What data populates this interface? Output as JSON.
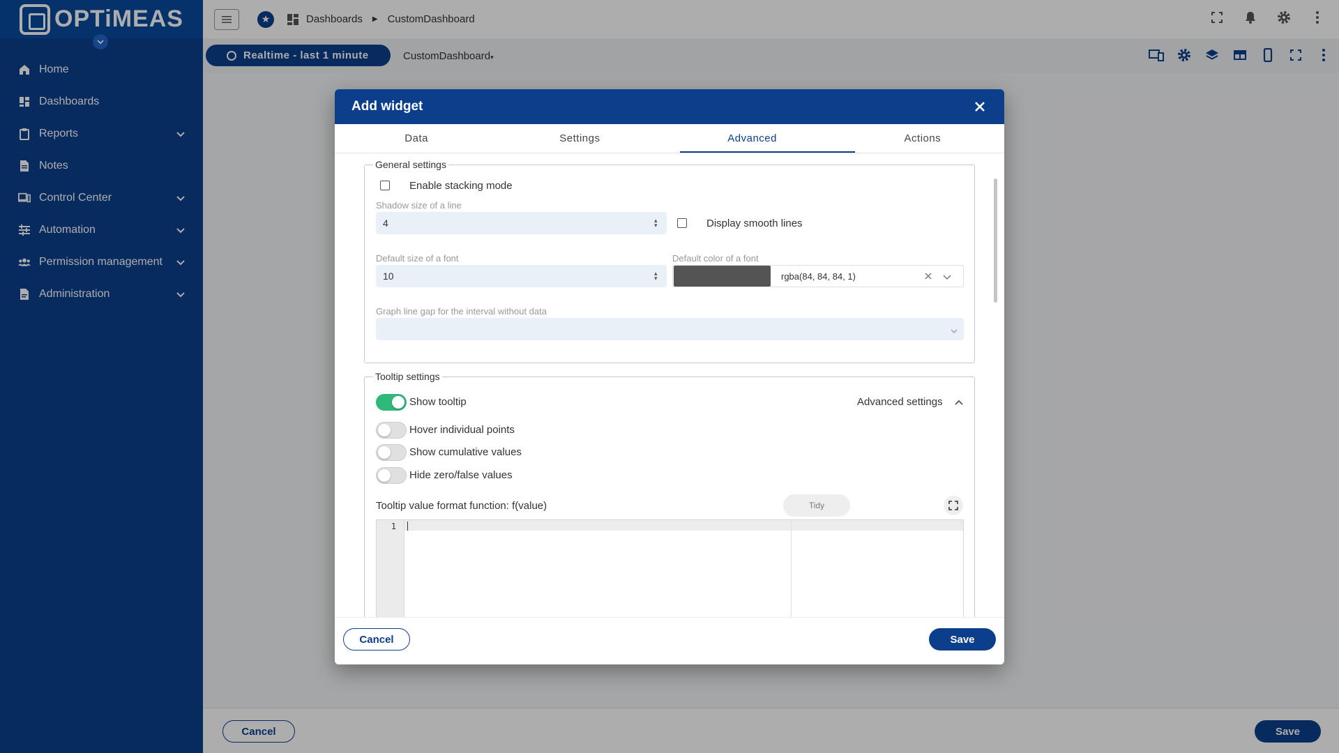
{
  "logo": {
    "text": "OPTiMEAS"
  },
  "sidebar": {
    "items": [
      {
        "label": "Home",
        "icon": "home-icon",
        "expandable": false
      },
      {
        "label": "Dashboards",
        "icon": "dashboard-icon",
        "expandable": false
      },
      {
        "label": "Reports",
        "icon": "clipboard-icon",
        "expandable": true
      },
      {
        "label": "Notes",
        "icon": "note-icon",
        "expandable": false
      },
      {
        "label": "Control Center",
        "icon": "monitor-icon",
        "expandable": true
      },
      {
        "label": "Automation",
        "icon": "sliders-icon",
        "expandable": true
      },
      {
        "label": "Permission management",
        "icon": "users-icon",
        "expandable": true
      },
      {
        "label": "Administration",
        "icon": "document-icon",
        "expandable": true
      }
    ]
  },
  "topbar": {
    "breadcrumb": [
      "Dashboards",
      "CustomDashboard"
    ]
  },
  "dashboard": {
    "realtime_label": "Realtime - last 1 minute",
    "selected_dashboard": "CustomDashboard",
    "cancel_label": "Cancel",
    "save_label": "Save"
  },
  "modal": {
    "title": "Add widget",
    "tabs": [
      "Data",
      "Settings",
      "Advanced",
      "Actions"
    ],
    "active_tab": "Advanced",
    "general": {
      "legend": "General settings",
      "stacking_label": "Enable stacking mode",
      "stacking_checked": false,
      "shadow_label": "Shadow size of a line",
      "shadow_value": "4",
      "smooth_label": "Display smooth lines",
      "smooth_checked": false,
      "font_size_label": "Default size of a font",
      "font_size_value": "10",
      "font_color_label": "Default color of a font",
      "font_color_value": "rgba(84, 84, 84, 1)",
      "font_color_swatch": "#545454",
      "gap_label": "Graph line gap for the interval without data",
      "gap_value": ""
    },
    "tooltip": {
      "legend": "Tooltip settings",
      "show_label": "Show tooltip",
      "show_on": true,
      "advanced_label": "Advanced settings",
      "hover_label": "Hover individual points",
      "hover_on": false,
      "cumulative_label": "Show cumulative values",
      "cumulative_on": false,
      "hide_zero_label": "Hide zero/false values",
      "hide_zero_on": false,
      "format_label": "Tooltip value format function: f(value)",
      "tidy_label": "Tidy",
      "editor_line": "1"
    },
    "cancel_label": "Cancel",
    "save_label": "Save"
  },
  "colors": {
    "primary": "#0b3f8c",
    "toggle_on": "#30b87b"
  }
}
